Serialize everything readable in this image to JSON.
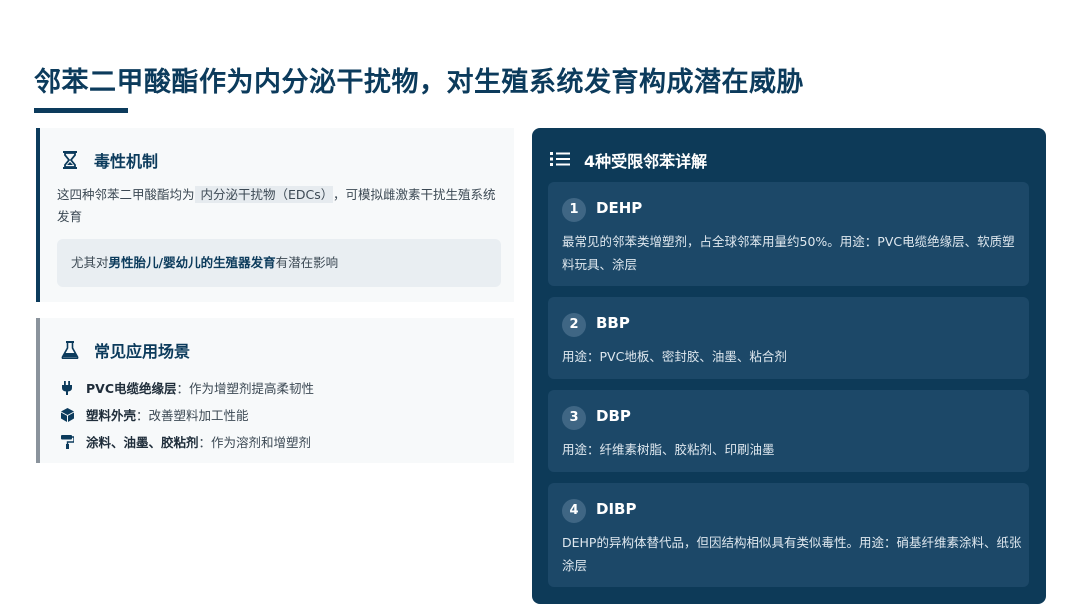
{
  "title": "邻苯二甲酸酯作为内分泌干扰物，对生殖系统发育构成潜在威胁",
  "mechanism": {
    "heading": "毒性机制",
    "text_before": "这四种邻苯二甲酸酯均为",
    "text_highlight": "内分泌干扰物（EDCs）",
    "text_after": "，可模拟雌激素干扰生殖系统发育",
    "note_before": "尤其对",
    "note_bold": "男性胎儿/婴幼儿的生殖器发育",
    "note_after": "有潜在影响"
  },
  "applications": {
    "heading": "常见应用场景",
    "items": [
      {
        "icon": "plug-icon",
        "bold": "PVC电缆绝缘层",
        "text": "：作为增塑剂提高柔韧性"
      },
      {
        "icon": "cube-icon",
        "bold": "塑料外壳",
        "text": "：改善塑料加工性能"
      },
      {
        "icon": "paint-roller-icon",
        "bold": "涂料、油墨、胶粘剂",
        "text": "：作为溶剂和增塑剂"
      }
    ]
  },
  "details": {
    "heading": "4种受限邻苯详解",
    "items": [
      {
        "num": "1",
        "name": "DEHP",
        "desc": "最常见的邻苯类增塑剂，占全球邻苯用量约50%。用途：PVC电缆绝缘层、软质塑料玩具、涂层"
      },
      {
        "num": "2",
        "name": "BBP",
        "desc": "用途：PVC地板、密封胶、油墨、粘合剂"
      },
      {
        "num": "3",
        "name": "DBP",
        "desc": "用途：纤维素树脂、胶粘剂、印刷油墨"
      },
      {
        "num": "4",
        "name": "DIBP",
        "desc": "DEHP的异构体替代品，但因结构相似具有类似毒性。用途：硝基纤维素涂料、纸张涂层"
      }
    ]
  },
  "colors": {
    "primary": "#0c3b5c",
    "panel": "#0d3a58",
    "item": "#1c4868"
  }
}
